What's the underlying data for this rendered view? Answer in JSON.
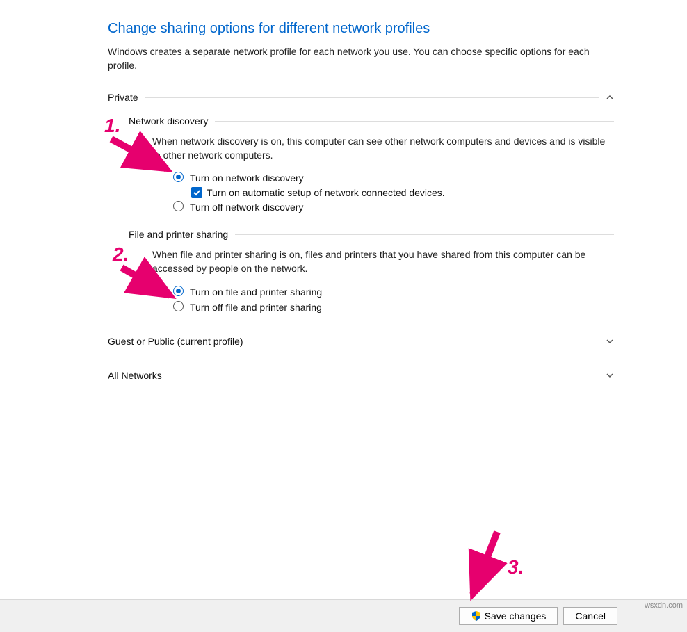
{
  "title": "Change sharing options for different network profiles",
  "description": "Windows creates a separate network profile for each network you use. You can choose specific options for each profile.",
  "profiles": {
    "private": {
      "label": "Private",
      "network_discovery": {
        "title": "Network discovery",
        "desc": "When network discovery is on, this computer can see other network computers and devices and is visible to other network computers.",
        "on_label": "Turn on network discovery",
        "auto_label": "Turn on automatic setup of network connected devices.",
        "off_label": "Turn off network discovery"
      },
      "file_printer": {
        "title": "File and printer sharing",
        "desc": "When file and printer sharing is on, files and printers that you have shared from this computer can be accessed by people on the network.",
        "on_label": "Turn on file and printer sharing",
        "off_label": "Turn off file and printer sharing"
      }
    },
    "guest": {
      "label": "Guest or Public (current profile)"
    },
    "all": {
      "label": "All Networks"
    }
  },
  "buttons": {
    "save": "Save changes",
    "cancel": "Cancel"
  },
  "annotations": {
    "n1": "1.",
    "n2": "2.",
    "n3": "3."
  },
  "watermark": "wsxdn.com"
}
